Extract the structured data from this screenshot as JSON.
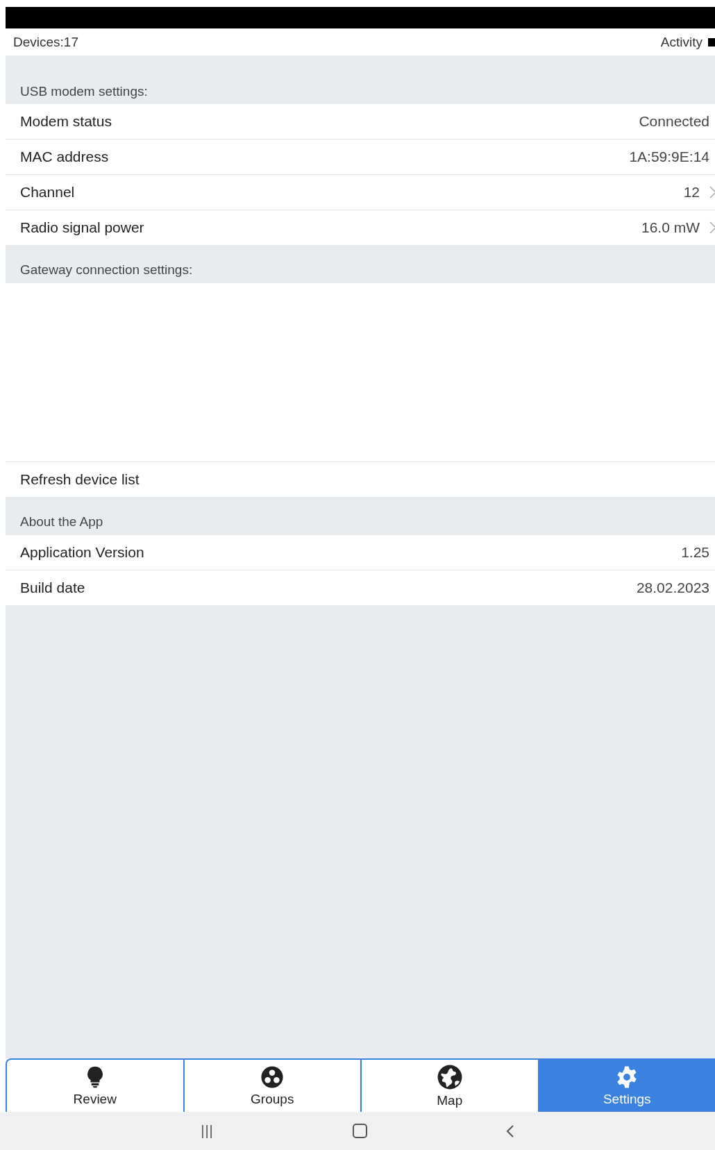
{
  "header": {
    "devices": "Devices:17",
    "activity": "Activity"
  },
  "sections": [
    {
      "kind": "list",
      "title": "USB modem settings:",
      "rows": [
        {
          "label": "Modem status",
          "value": "Connected",
          "chevron": false
        },
        {
          "label": "MAC address",
          "value": "1A:59:9E:14",
          "chevron": false
        },
        {
          "label": "Channel",
          "value": "12",
          "chevron": true
        },
        {
          "label": "Radio signal power",
          "value": "16.0 mW",
          "chevron": true
        }
      ]
    },
    {
      "kind": "blank",
      "title": "Gateway connection settings:",
      "rows": [
        {
          "label": "Refresh device list",
          "chevron": false
        }
      ]
    },
    {
      "kind": "list",
      "title": "About the App",
      "rows": [
        {
          "label": "Application Version",
          "value": "1.25",
          "chevron": false
        },
        {
          "label": "Build date",
          "value": "28.02.2023",
          "chevron": false
        }
      ]
    }
  ],
  "tabs": [
    {
      "label": "Review",
      "kind": "bulb",
      "selected": false
    },
    {
      "label": "Groups",
      "kind": "groups",
      "selected": false
    },
    {
      "label": "Map",
      "kind": "globe",
      "selected": false
    },
    {
      "label": "Settings",
      "kind": "gear",
      "selected": true
    }
  ],
  "navbar": {
    "recents": "|||"
  }
}
